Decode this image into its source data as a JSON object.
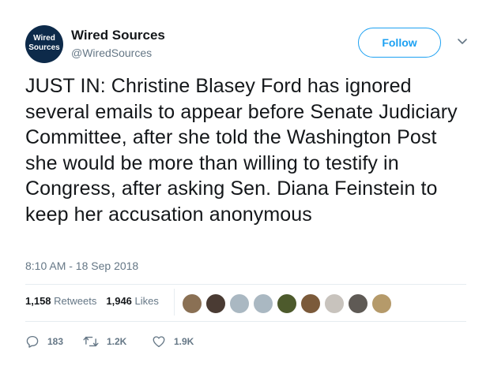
{
  "user": {
    "avatar_text_line1": "Wired",
    "avatar_text_line2": "Sources",
    "display_name": "Wired Sources",
    "handle": "@WiredSources"
  },
  "follow_label": "Follow",
  "tweet": {
    "text": "JUST IN: Christine Blasey Ford has ignored several emails to appear before Senate Judiciary Committee, after she told the Washington Post she would be more than willing to testify in Congress, after asking Sen. Diana Feinstein to keep her accusation anonymous",
    "timestamp": "8:10 AM - 18 Sep 2018"
  },
  "stats": {
    "retweets_count": "1,158",
    "retweets_label": "Retweets",
    "likes_count": "1,946",
    "likes_label": "Likes"
  },
  "likers": [
    {
      "name": "liker-avatar-1",
      "color": "#8a7054"
    },
    {
      "name": "liker-avatar-2",
      "color": "#4a3b33"
    },
    {
      "name": "liker-avatar-3",
      "color": "#aab8c2"
    },
    {
      "name": "liker-avatar-4",
      "color": "#aab8c2"
    },
    {
      "name": "liker-avatar-5",
      "color": "#4d5a2c"
    },
    {
      "name": "liker-avatar-6",
      "color": "#7b5a3a"
    },
    {
      "name": "liker-avatar-7",
      "color": "#c8c3bd"
    },
    {
      "name": "liker-avatar-8",
      "color": "#5f5a55"
    },
    {
      "name": "liker-avatar-9",
      "color": "#b59a6a"
    }
  ],
  "actions": {
    "reply_count": "183",
    "retweet_count": "1.2K",
    "like_count": "1.9K"
  },
  "colors": {
    "accent": "#1da1f2",
    "muted": "#657786",
    "text": "#14171a"
  }
}
